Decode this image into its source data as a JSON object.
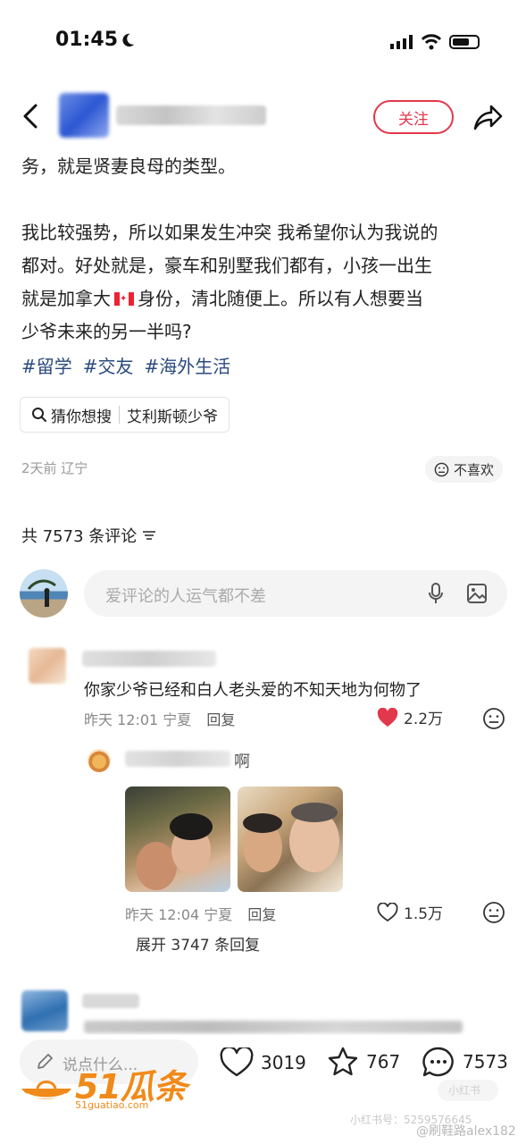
{
  "status_bar": {
    "time": "01:45"
  },
  "header": {
    "follow_label": "关注"
  },
  "post": {
    "lines": [
      "务，就是贤妻良母的类型。",
      "我比较强势，所以如果发生冲突 我希望你认为我说的",
      "都对。好处就是，豪车和别墅我们都有，小孩一出生",
      "就是加拿大",
      "身份，清北随便上。所以有人想要当",
      "少爷未来的另一半吗?"
    ],
    "tags": [
      "#留学",
      "#交友",
      "#海外生活"
    ],
    "search_chip": {
      "label": "猜你想搜",
      "query": "艾利斯顿少爷"
    },
    "meta": "2天前 辽宁",
    "dislike_label": "不喜欢"
  },
  "comments_section": {
    "count_label": "共 7573 条评论",
    "input_placeholder": "爱评论的人运气都不差"
  },
  "comments": [
    {
      "text": "你家少爷已经和白人老头爱的不知天地为何物了",
      "time_loc": "昨天 12:01 宁夏",
      "reply_label": "回复",
      "likes": "2.2万",
      "liked": true,
      "reply": {
        "text_visible": "啊",
        "time_loc": "昨天 12:04 宁夏",
        "reply_label": "回复",
        "likes": "1.5万"
      },
      "expand_label": "展开 3747 条回复"
    }
  ],
  "bottom_bar": {
    "input_placeholder": "说点什么...",
    "likes": "3019",
    "favorites": "767",
    "comments": "7573"
  },
  "watermarks": {
    "logo": "51瓜条",
    "logo_url": "51guatiao.com",
    "wm1": "小红书号：5259576645",
    "wm2": "@刷鞋路alex182",
    "pill": "小红书"
  },
  "colors": {
    "accent": "#e2384b",
    "tag": "#2a4a7d",
    "logo": "#f08a1a"
  }
}
